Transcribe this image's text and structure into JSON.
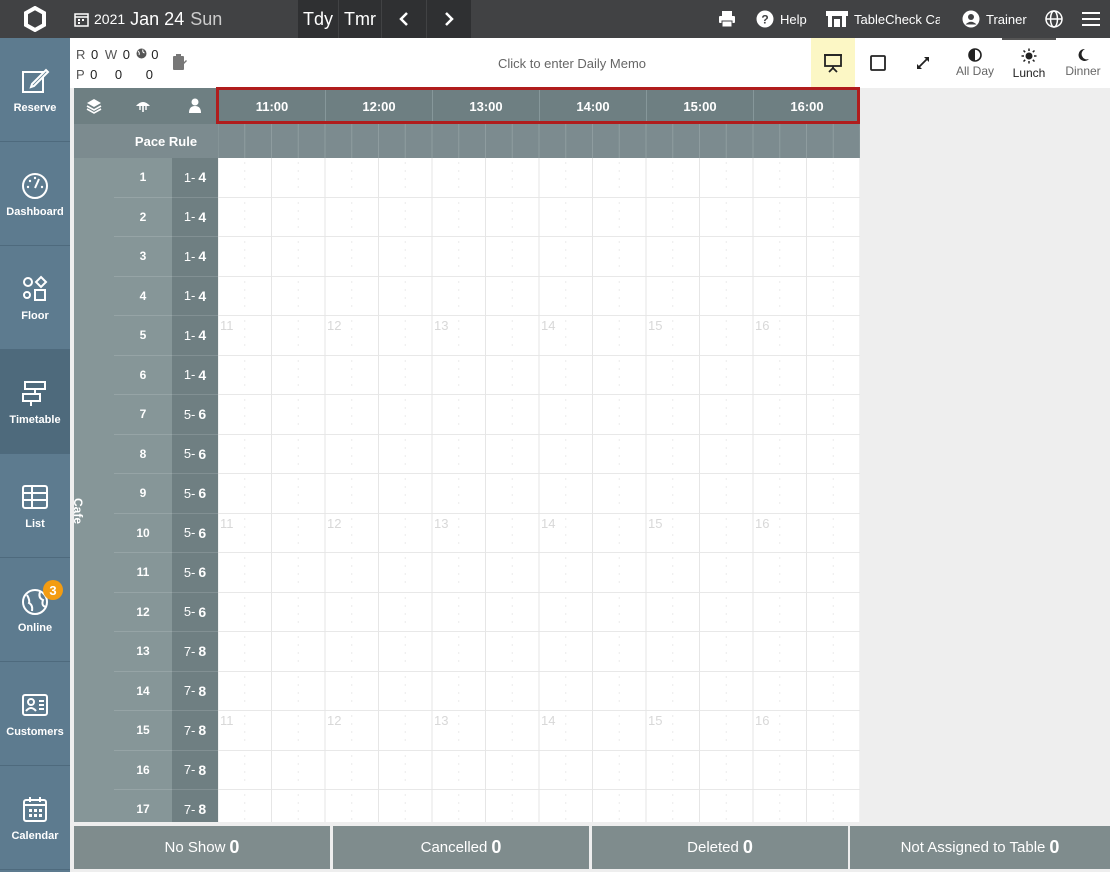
{
  "topbar": {
    "year": "2021",
    "date": "Jan 24",
    "weekday": "Sun",
    "today": "Tdy",
    "tomorrow": "Tmr",
    "help": "Help",
    "shop": "TableCheck Cal",
    "user": "Trainer"
  },
  "nav": [
    {
      "label": "Reserve",
      "icon": "edit-icon"
    },
    {
      "label": "Dashboard",
      "icon": "gauge-icon"
    },
    {
      "label": "Floor",
      "icon": "shapes-icon"
    },
    {
      "label": "Timetable",
      "icon": "timetable-icon"
    },
    {
      "label": "List",
      "icon": "table-icon"
    },
    {
      "label": "Online",
      "icon": "globe-icon",
      "badge": "3"
    },
    {
      "label": "Customers",
      "icon": "id-card-icon"
    },
    {
      "label": "Calendar",
      "icon": "calendar-icon"
    }
  ],
  "stats": {
    "r_label": "R",
    "r": "0",
    "w_label": "W",
    "w": "0",
    "g": "0",
    "p_label": "P",
    "p": "0",
    "p2": "0",
    "p3": "0"
  },
  "memo": "Click to enter Daily Memo",
  "periods": [
    {
      "label": "All Day",
      "selected": false
    },
    {
      "label": "Lunch",
      "selected": true
    },
    {
      "label": "Dinner",
      "selected": false
    }
  ],
  "timeline": {
    "hours": [
      "11:00",
      "12:00",
      "13:00",
      "14:00",
      "15:00",
      "16:00"
    ],
    "watermarks": [
      "11",
      "12",
      "13",
      "14",
      "15",
      "16"
    ],
    "pace_rule": "Pace Rule"
  },
  "area": {
    "name": "Cafe"
  },
  "tables": [
    {
      "num": "1",
      "min": "1",
      "max": "4"
    },
    {
      "num": "2",
      "min": "1",
      "max": "4"
    },
    {
      "num": "3",
      "min": "1",
      "max": "4"
    },
    {
      "num": "4",
      "min": "1",
      "max": "4"
    },
    {
      "num": "5",
      "min": "1",
      "max": "4"
    },
    {
      "num": "6",
      "min": "1",
      "max": "4"
    },
    {
      "num": "7",
      "min": "5",
      "max": "6"
    },
    {
      "num": "8",
      "min": "5",
      "max": "6"
    },
    {
      "num": "9",
      "min": "5",
      "max": "6"
    },
    {
      "num": "10",
      "min": "5",
      "max": "6"
    },
    {
      "num": "11",
      "min": "5",
      "max": "6"
    },
    {
      "num": "12",
      "min": "5",
      "max": "6"
    },
    {
      "num": "13",
      "min": "7",
      "max": "8"
    },
    {
      "num": "14",
      "min": "7",
      "max": "8"
    },
    {
      "num": "15",
      "min": "7",
      "max": "8"
    },
    {
      "num": "16",
      "min": "7",
      "max": "8"
    },
    {
      "num": "17",
      "min": "7",
      "max": "8"
    }
  ],
  "bottom": [
    {
      "label": "No Show",
      "count": "0"
    },
    {
      "label": "Cancelled",
      "count": "0"
    },
    {
      "label": "Deleted",
      "count": "0"
    },
    {
      "label": "Not Assigned to Table",
      "count": "0"
    }
  ]
}
